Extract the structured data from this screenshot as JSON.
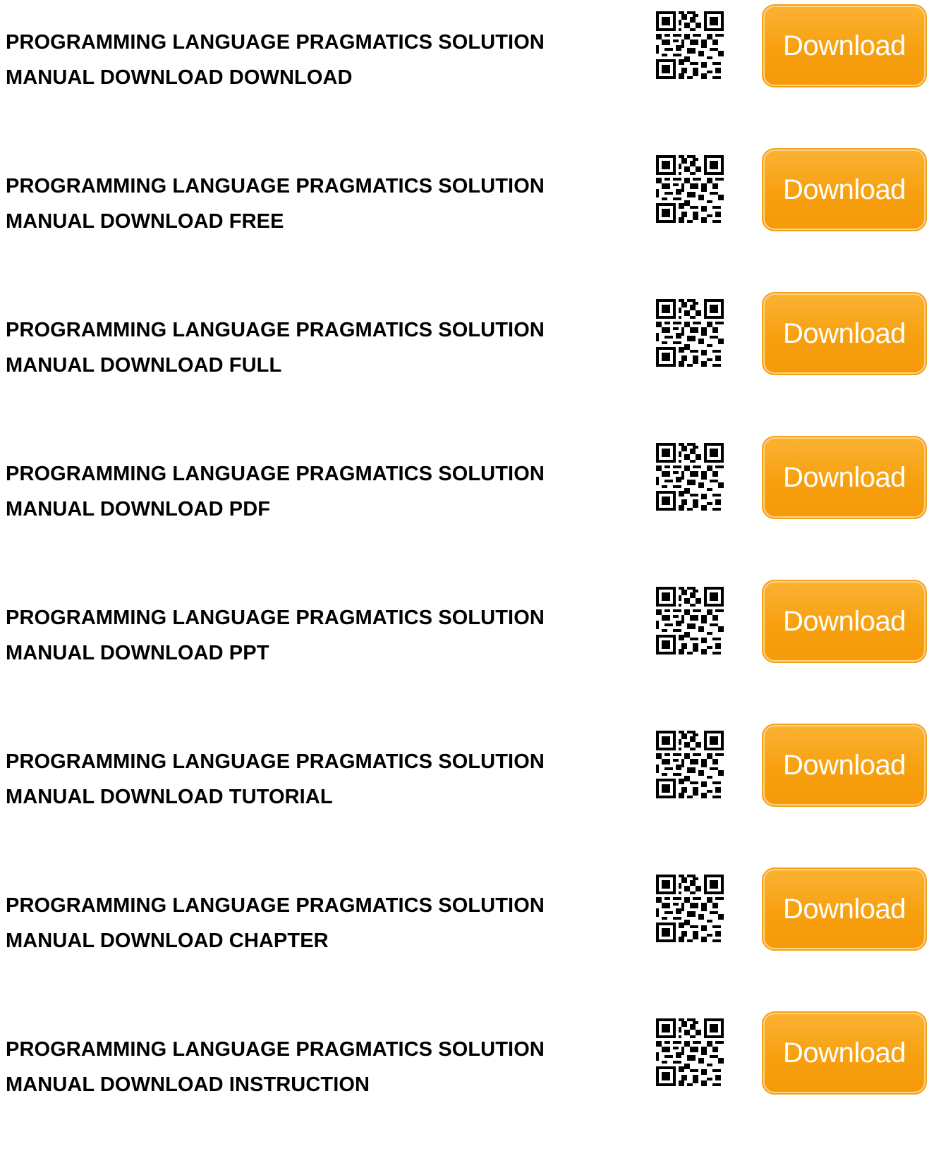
{
  "colors": {
    "button_bg": "#f7a00f",
    "button_text": "#ffffff",
    "title_text": "#000000",
    "background": "#ffffff"
  },
  "qr_icon": "qr-code-icon",
  "items": [
    {
      "title": "PROGRAMMING LANGUAGE PRAGMATICS SOLUTION MANUAL DOWNLOAD DOWNLOAD",
      "button_label": "Download"
    },
    {
      "title": "PROGRAMMING LANGUAGE PRAGMATICS SOLUTION MANUAL DOWNLOAD FREE",
      "button_label": "Download"
    },
    {
      "title": "PROGRAMMING LANGUAGE PRAGMATICS SOLUTION MANUAL DOWNLOAD FULL",
      "button_label": "Download"
    },
    {
      "title": "PROGRAMMING LANGUAGE PRAGMATICS SOLUTION MANUAL DOWNLOAD PDF",
      "button_label": "Download"
    },
    {
      "title": "PROGRAMMING LANGUAGE PRAGMATICS SOLUTION MANUAL DOWNLOAD PPT",
      "button_label": "Download"
    },
    {
      "title": "PROGRAMMING LANGUAGE PRAGMATICS SOLUTION MANUAL DOWNLOAD TUTORIAL",
      "button_label": "Download"
    },
    {
      "title": "PROGRAMMING LANGUAGE PRAGMATICS SOLUTION MANUAL DOWNLOAD CHAPTER",
      "button_label": "Download"
    },
    {
      "title": "PROGRAMMING LANGUAGE PRAGMATICS SOLUTION MANUAL DOWNLOAD INSTRUCTION",
      "button_label": "Download"
    }
  ]
}
